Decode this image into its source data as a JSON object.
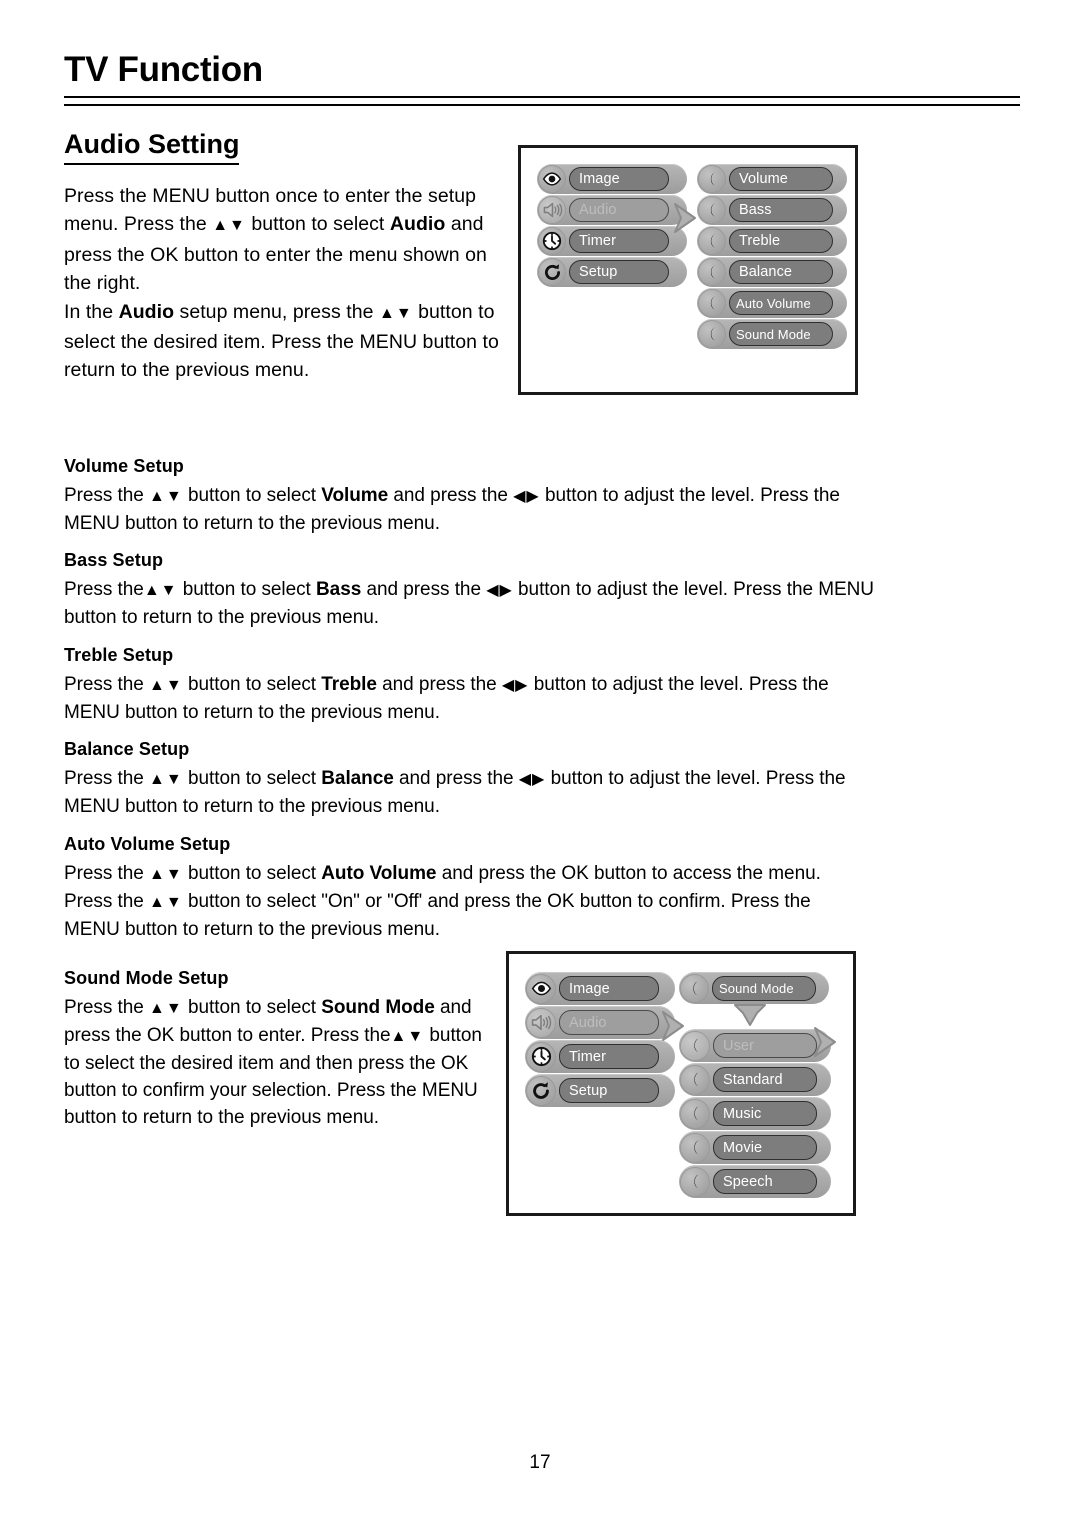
{
  "document": {
    "chapter_title": "TV Function",
    "section_title": "Audio Setting",
    "page_number": "17"
  },
  "intro": {
    "line1_a": "Press the MENU button once to enter the setup menu. Press the ",
    "arrows_updown": "▲▼",
    "line1_b": " button to select ",
    "bold_audio": "Audio",
    "line1_c": " and press the OK button to enter the menu shown on the right.",
    "line2_a": "In the ",
    "bold_audio2": "Audio",
    "line2_b": " setup menu, press the ",
    "line2_c": " button to select the desired item. Press the MENU button to return to the previous menu."
  },
  "sections": [
    {
      "id": "volume",
      "heading": "Volume Setup",
      "body_a": "Press the ",
      "arrows_ud": "▲▼",
      "body_b": " button to select ",
      "bold_term": "Volume",
      "body_c": " and press the ",
      "arrows_lr": "◀▶",
      "body_d": " button to adjust the level. Press the MENU button to return to the previous menu."
    },
    {
      "id": "bass",
      "heading": "Bass Setup",
      "body_a": "Press the",
      "arrows_ud": "▲▼",
      "body_b": " button to select ",
      "bold_term": "Bass",
      "body_c": " and press the ",
      "arrows_lr": "◀▶",
      "body_d": " button to adjust the level. Press the MENU button to return to the previous menu."
    },
    {
      "id": "treble",
      "heading": "Treble Setup",
      "body_a": "Press the ",
      "arrows_ud": "▲▼",
      "body_b": " button to select ",
      "bold_term": "Treble",
      "body_c": " and press the ",
      "arrows_lr": "◀▶",
      "body_d": " button to adjust the level. Press the MENU button to return to the previous menu."
    },
    {
      "id": "balance",
      "heading": "Balance Setup",
      "body_a": "Press the ",
      "arrows_ud": "▲▼",
      "body_b": " button to select ",
      "bold_term": "Balance",
      "body_c": " and press the ",
      "arrows_lr": "◀▶",
      "body_d": " button to adjust the level. Press the MENU button to return to the previous menu."
    },
    {
      "id": "auto-volume",
      "heading": "Auto Volume Setup",
      "body_a": "Press the ",
      "arrows_ud": "▲▼",
      "body_b": " button to select ",
      "bold_term": "Auto Volume",
      "body_c": " and press the OK button to access the menu. Press the ",
      "arrows_ud2": "▲▼",
      "body_d": " button to select \"On\" or \"Off' and press the OK button to confirm. Press the MENU button to return to the previous menu."
    },
    {
      "id": "sound-mode",
      "heading": "Sound Mode Setup",
      "body_a": "Press the ",
      "arrows_ud": "▲▼",
      "body_b": " button to select ",
      "bold_term": "Sound Mode",
      "body_c": " and press the OK button to enter. Press the",
      "arrows_ud2": "▲▼",
      "body_d": " button to select the desired item and then press the OK button to confirm your selection. Press the MENU button to return to the previous menu."
    }
  ],
  "osd_audio": {
    "left_column": [
      {
        "label": "Image",
        "icon": "eye-icon",
        "selected": false
      },
      {
        "label": "Audio",
        "icon": "speaker-icon",
        "selected": true
      },
      {
        "label": "Timer",
        "icon": "clock-icon",
        "selected": false
      },
      {
        "label": "Setup",
        "icon": "refresh-icon",
        "selected": false
      }
    ],
    "right_column": [
      {
        "label": "Volume",
        "icon": "crescent-icon",
        "small": false
      },
      {
        "label": "Bass",
        "icon": "crescent-icon",
        "small": false
      },
      {
        "label": "Treble",
        "icon": "crescent-icon",
        "small": false
      },
      {
        "label": "Balance",
        "icon": "crescent-icon",
        "small": false
      },
      {
        "label": "Auto Volume",
        "icon": "crescent-icon",
        "small": true
      },
      {
        "label": "Sound Mode",
        "icon": "crescent-icon",
        "small": true
      }
    ]
  },
  "osd_sound_mode": {
    "left_column": [
      {
        "label": "Image",
        "icon": "eye-icon",
        "selected": false
      },
      {
        "label": "Audio",
        "icon": "speaker-icon",
        "selected": true
      },
      {
        "label": "Timer",
        "icon": "clock-icon",
        "selected": false
      },
      {
        "label": "Setup",
        "icon": "refresh-icon",
        "selected": false
      }
    ],
    "parent_item": {
      "label": "Sound Mode",
      "icon": "crescent-icon"
    },
    "options": [
      {
        "label": "User",
        "icon": "crescent-icon",
        "selected": true
      },
      {
        "label": "Standard",
        "icon": "crescent-icon",
        "selected": false
      },
      {
        "label": "Music",
        "icon": "crescent-icon",
        "selected": false
      },
      {
        "label": "Movie",
        "icon": "crescent-icon",
        "selected": false
      },
      {
        "label": "Speech",
        "icon": "crescent-icon",
        "selected": false
      }
    ]
  },
  "colors": {
    "tray": "#a8a8a8",
    "pill": "#7d7d7d",
    "pill_selected": "#9e9e9e",
    "pill_text": "#ffffff",
    "pill_text_selected": "#bdbdbd",
    "border": "#2f2f2f",
    "box_border": "#1a1a1a",
    "page_background": "#ffffff",
    "text": "#000000"
  }
}
